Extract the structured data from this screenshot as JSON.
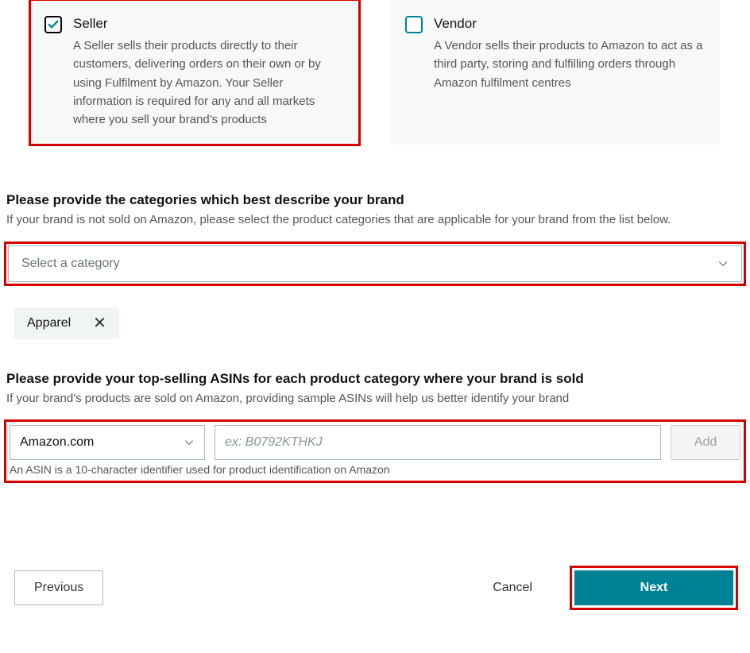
{
  "cards": {
    "seller": {
      "title": "Seller",
      "description": "A Seller sells their products directly to their customers, delivering orders on their own or by using Fulfilment by Amazon. Your Seller information is required for any and all markets where you sell your brand's products",
      "checked": true
    },
    "vendor": {
      "title": "Vendor",
      "description": "A Vendor sells their products to Amazon to act as a third party, storing and fulfilling orders through Amazon fulfilment centres",
      "checked": false
    }
  },
  "categories_section": {
    "heading": "Please provide the categories which best describe your brand",
    "sub": "If your brand is not sold on Amazon, please select the product categories that are applicable for your brand from the list below.",
    "placeholder": "Select a category",
    "selected_tags": [
      "Apparel"
    ]
  },
  "asin_section": {
    "heading": "Please provide your top-selling ASINs for each product category where your brand is sold",
    "sub": "If your brand's products are sold on Amazon, providing sample ASINs will help us better identify your brand",
    "marketplace_value": "Amazon.com",
    "asin_placeholder": "ex: B0792KTHKJ",
    "add_label": "Add",
    "hint": "An ASIN is a 10-character identifier used for product identification on Amazon"
  },
  "footer": {
    "previous": "Previous",
    "cancel": "Cancel",
    "next": "Next"
  }
}
